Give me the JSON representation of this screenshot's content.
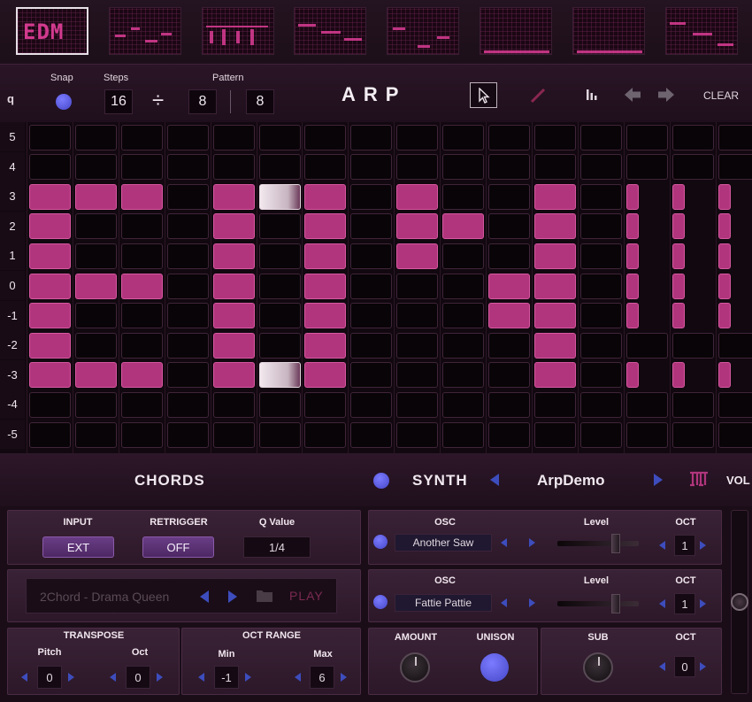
{
  "thumbs": [
    {
      "name": "EDM",
      "selected": true
    },
    {
      "name": "",
      "selected": false
    },
    {
      "name": "",
      "selected": false
    },
    {
      "name": "",
      "selected": false
    },
    {
      "name": "",
      "selected": false
    },
    {
      "name": "",
      "selected": false
    },
    {
      "name": "",
      "selected": false
    },
    {
      "name": "",
      "selected": false
    }
  ],
  "toolbar": {
    "quantize_icon_label": "q",
    "snap_label": "Snap",
    "steps_label": "Steps",
    "steps_value": "16",
    "divide_symbol": "÷",
    "steps_div_value": "8",
    "pattern_label": "Pattern",
    "pattern_value": "8",
    "title": "ARP",
    "clear_label": "CLEAR"
  },
  "grid": {
    "row_labels": [
      "5",
      "4",
      "3",
      "2",
      "1",
      "0",
      "-1",
      "-2",
      "-3",
      "-4",
      "-5"
    ],
    "columns": 16,
    "active": {
      "3": [
        0,
        1,
        2,
        4,
        5,
        6,
        8,
        11,
        13,
        14,
        15
      ],
      "2": [
        0,
        4,
        6,
        8,
        9,
        11,
        13,
        14,
        15
      ],
      "1": [
        0,
        4,
        6,
        8,
        11,
        13,
        14,
        15
      ],
      "0": [
        0,
        1,
        2,
        4,
        6,
        10,
        11,
        13,
        14,
        15
      ],
      "-1": [
        0,
        4,
        6,
        10,
        11,
        13,
        14,
        15
      ],
      "-2": [
        0,
        4,
        6,
        11
      ],
      "-3": [
        0,
        1,
        2,
        4,
        5,
        6,
        11,
        13,
        14,
        15
      ]
    },
    "ghost_cells": [
      "3:5",
      "-3:5"
    ],
    "narrow_columns": [
      13,
      14,
      15
    ]
  },
  "chords_header": {
    "chords_label": "CHORDS",
    "synth_label": "SYNTH",
    "preset_name": "ArpDemo",
    "vol_label": "VOL"
  },
  "input_panel": {
    "input_label": "INPUT",
    "input_value": "EXT",
    "retrigger_label": "RETRIGGER",
    "retrigger_value": "OFF",
    "qvalue_label": "Q Value",
    "qvalue_value": "1/4"
  },
  "chord_panel": {
    "chord_name": "2Chord - Drama Queen",
    "play_label": "PLAY"
  },
  "transpose_panel": {
    "title": "TRANSPOSE",
    "pitch_label": "Pitch",
    "pitch_value": "0",
    "oct_label": "Oct",
    "oct_value": "0"
  },
  "octrange_panel": {
    "title": "OCT RANGE",
    "min_label": "Min",
    "min_value": "-1",
    "max_label": "Max",
    "max_value": "6"
  },
  "osc1": {
    "label": "OSC",
    "wave": "Another Saw",
    "level_label": "Level",
    "level": 0.72,
    "oct_label": "OCT",
    "oct_value": "1"
  },
  "osc2": {
    "label": "OSC",
    "wave": "Fattie Pattie",
    "level_label": "Level",
    "level": 0.72,
    "oct_label": "OCT",
    "oct_value": "1"
  },
  "bottom_synth": {
    "amount_label": "AMOUNT",
    "unison_label": "UNISON",
    "sub_label": "SUB",
    "oct_label": "OCT",
    "oct_value": "0"
  },
  "colors": {
    "active_cell": "#b0357c",
    "accent_blue": "#4646c8",
    "background": "#1a0d18"
  }
}
